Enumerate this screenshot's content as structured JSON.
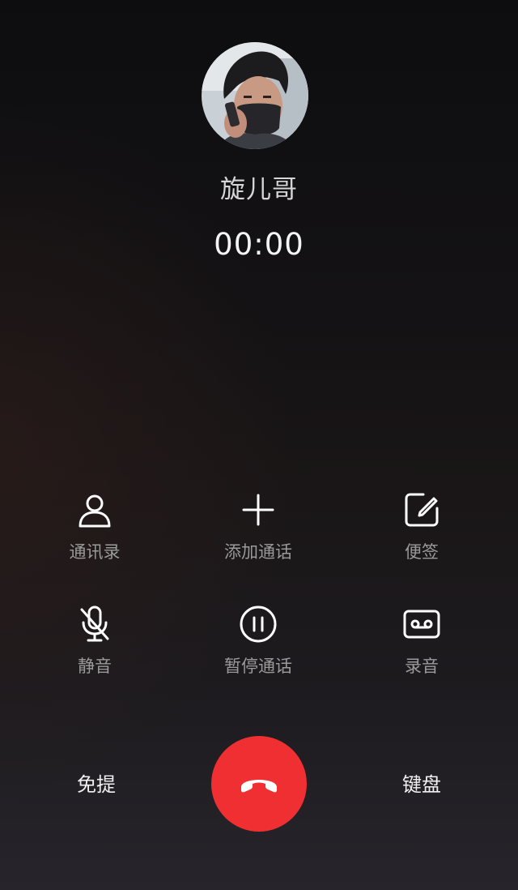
{
  "caller": {
    "name": "旋儿哥",
    "timer": "00:00"
  },
  "actions_row1": [
    {
      "label": "通讯录",
      "icon": "contacts-icon"
    },
    {
      "label": "添加通话",
      "icon": "plus-icon"
    },
    {
      "label": "便签",
      "icon": "note-edit-icon"
    }
  ],
  "actions_row2": [
    {
      "label": "静音",
      "icon": "mic-off-icon"
    },
    {
      "label": "暂停通话",
      "icon": "pause-icon"
    },
    {
      "label": "录音",
      "icon": "record-icon"
    }
  ],
  "bottom": {
    "speaker_label": "免提",
    "keypad_label": "键盘",
    "end_call_icon": "phone-hangup-icon"
  },
  "colors": {
    "end_call": "#ef2f31",
    "label": "#9a9a9a"
  }
}
